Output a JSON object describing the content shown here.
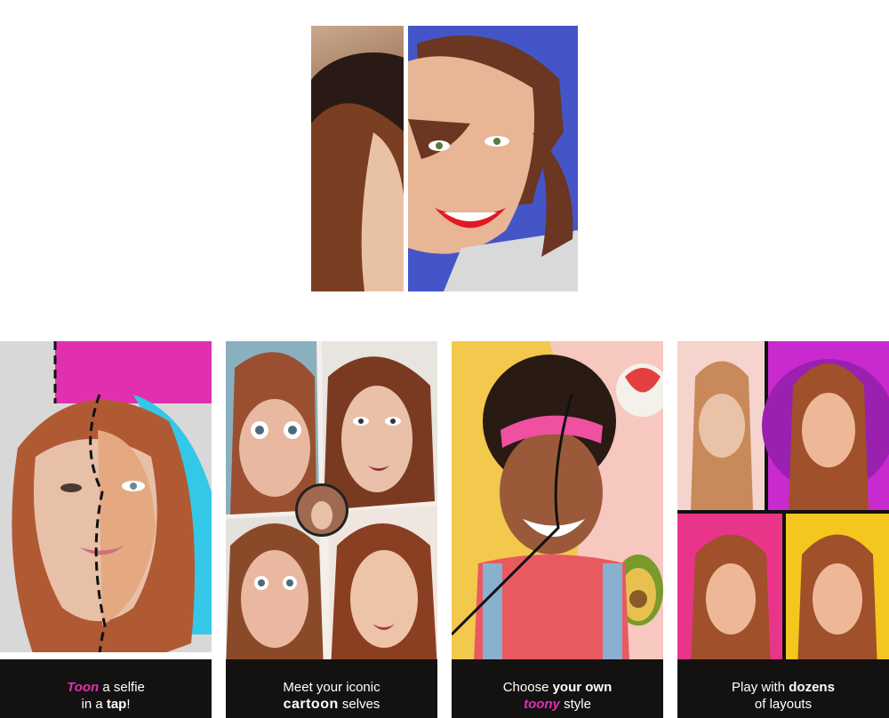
{
  "hero": {
    "label": "Before and after cartoon portrait",
    "colors": {
      "toon_bg": "#4455c8",
      "divider": "#ffffff"
    }
  },
  "cards": [
    {
      "caption": {
        "line1_highlight": "Toon",
        "line1_rest": " a selfie",
        "line2_prefix": "in a ",
        "line2_bold": "tap",
        "line2_suffix": "!"
      },
      "colors": {
        "accent": "#e030b0",
        "secondary": "#33c8e8"
      }
    },
    {
      "caption": {
        "line1": "Meet your iconic",
        "line2_bold": "cartoon",
        "line2_rest": " selves"
      }
    },
    {
      "caption": {
        "line1_prefix": "Choose ",
        "line1_bold": "your own",
        "line2_highlight": "toony",
        "line2_rest": " style"
      },
      "colors": {
        "bg": "#f2c94c"
      }
    },
    {
      "caption": {
        "line1_prefix": "Play with ",
        "line1_bold": "dozens",
        "line2": "of layouts"
      },
      "colors": {
        "magenta": "#c82ad0",
        "yellow": "#f4c61e",
        "pink": "#e8358a"
      }
    }
  ]
}
